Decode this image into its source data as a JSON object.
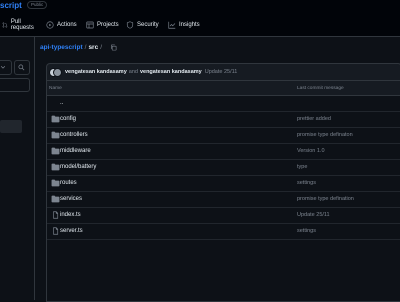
{
  "repo": {
    "name": "script",
    "visibility": "Public"
  },
  "tabs": [
    {
      "label": "Pull requests"
    },
    {
      "label": "Actions"
    },
    {
      "label": "Projects"
    },
    {
      "label": "Security"
    },
    {
      "label": "Insights"
    }
  ],
  "breadcrumb": {
    "repo": "api-typescript",
    "sep1": "/",
    "folder": "src",
    "sep2": "/"
  },
  "commit": {
    "author1": "vengatesan kandasamy",
    "and": "and",
    "author2": "vengatesan kandasamy",
    "message": "Update 25/11"
  },
  "table": {
    "col_name": "Name",
    "col_commit": "Last commit message",
    "rows": [
      {
        "name": "..",
        "type": "parent",
        "message": ""
      },
      {
        "name": "config",
        "type": "folder",
        "message": "prettier added"
      },
      {
        "name": "controllers",
        "type": "folder",
        "message": "promise type definaton"
      },
      {
        "name": "middleware",
        "type": "folder",
        "message": "Version 1.0"
      },
      {
        "name": "model/battery",
        "type": "folder",
        "message": "type"
      },
      {
        "name": "routes",
        "type": "folder",
        "message": "settings"
      },
      {
        "name": "services",
        "type": "folder",
        "message": "promise type defination"
      },
      {
        "name": "index.ts",
        "type": "file",
        "message": "Update 25/11"
      },
      {
        "name": "server.ts",
        "type": "file",
        "message": "settings"
      }
    ]
  },
  "colors": {
    "bg": "#0d1117",
    "header": "#010409",
    "accent": "#2f81f7",
    "folder": "#7d8590",
    "border": "#30363d"
  }
}
